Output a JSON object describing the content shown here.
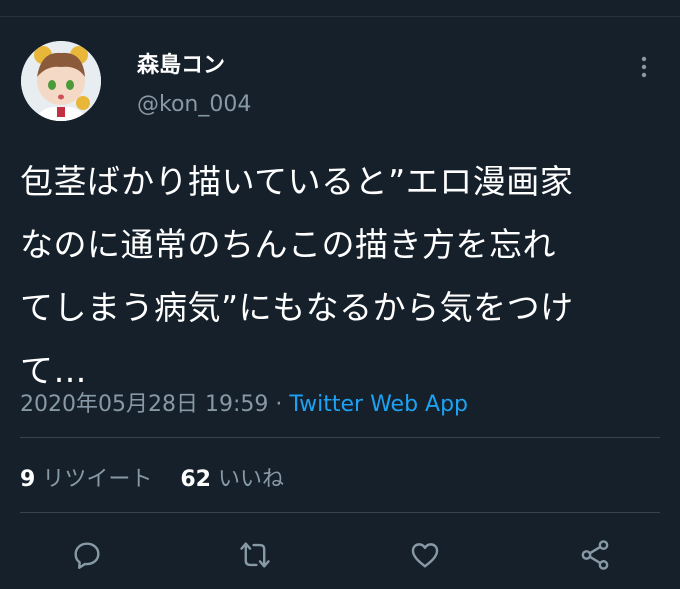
{
  "user": {
    "display_name": "森島コン",
    "handle": "@kon_004"
  },
  "tweet": {
    "lines": [
      "包茎ばかり描いていると”エロ漫画家",
      "なのに通常のちんこの描き方を忘れ",
      "てしまう病気”にもなるから気をつけ",
      "て…"
    ],
    "timestamp": "2020年05月28日 19:59",
    "separator": " · ",
    "source": "Twitter Web App"
  },
  "stats": {
    "retweets_count": "9",
    "retweets_label": "リツイート",
    "likes_count": "62",
    "likes_label": "いいね"
  },
  "actions": [
    "reply-icon",
    "retweet-icon",
    "like-icon",
    "share-icon"
  ],
  "colors": {
    "background": "#15202b",
    "link": "#1da1f2",
    "secondary": "#8899a6"
  }
}
